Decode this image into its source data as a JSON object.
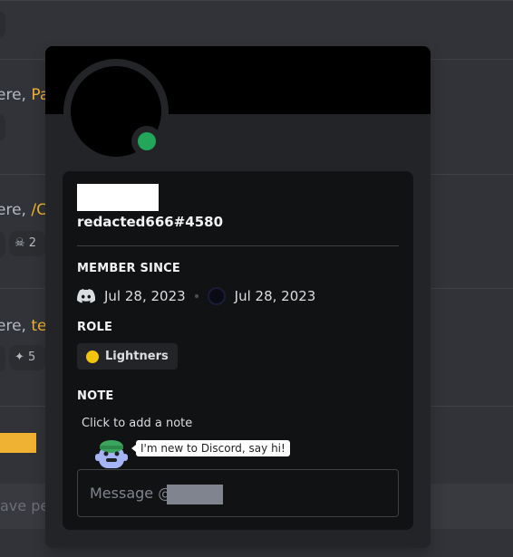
{
  "background": {
    "fragments": [
      {
        "prefix": "ere, ",
        "highlight": "Pa"
      },
      {
        "prefix": "ere, ",
        "highlight": "/C"
      },
      {
        "prefix": "ere, ",
        "highlight": "te"
      }
    ],
    "reaction_text": [
      "2",
      "5"
    ],
    "input_fragment": "ave pe"
  },
  "profile": {
    "display_name": "",
    "username": "redacted666#4580",
    "status_color": "#23a55a",
    "member_since": {
      "heading": "MEMBER SINCE",
      "discord_date": "Jul 28, 2023",
      "server_date": "Jul 28, 2023"
    },
    "role": {
      "heading": "ROLE",
      "name": "Lightners",
      "color": "#f1c40f"
    },
    "note": {
      "heading": "NOTE",
      "placeholder": "Click to add a note"
    },
    "wumpus_bubble": "I'm new to Discord, say hi!",
    "message_placeholder": "Message @"
  }
}
